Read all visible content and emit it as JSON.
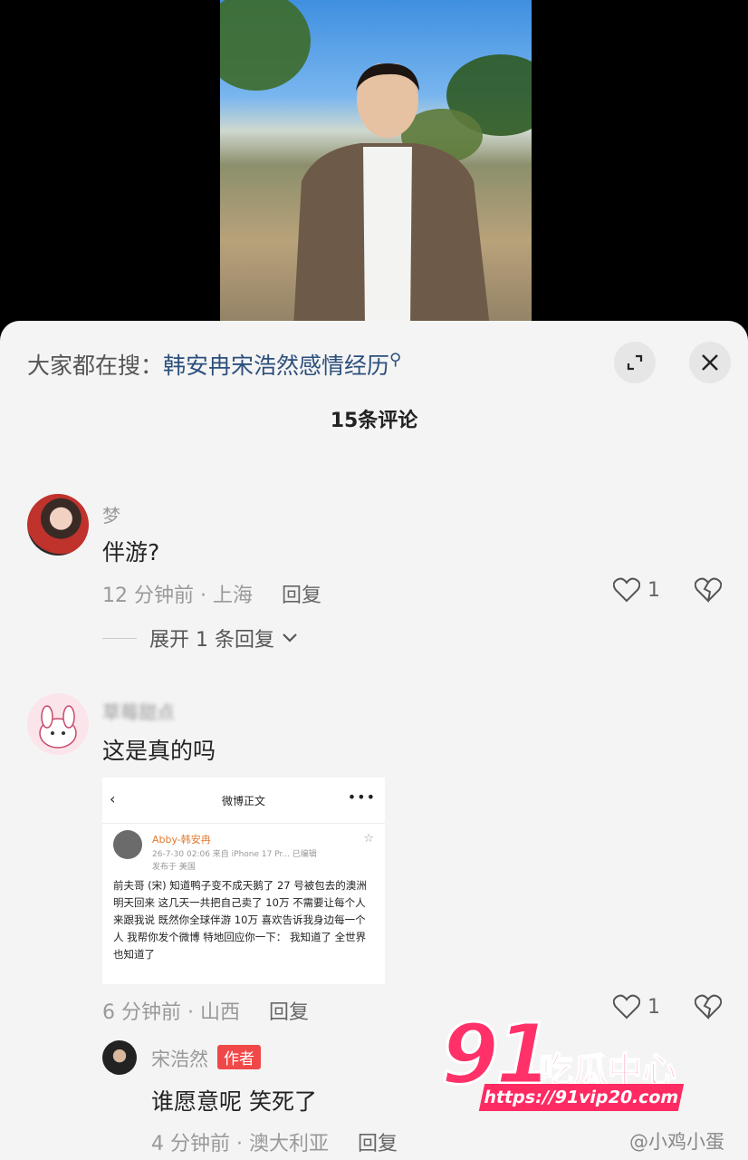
{
  "search": {
    "prefix": "大家都在搜：",
    "query": "韩安冉宋浩然感情经历"
  },
  "comment_count": "15条评论",
  "comments": [
    {
      "username": "梦",
      "text": "伴游?",
      "time_location": "12 分钟前 · 上海",
      "reply_label": "回复",
      "likes": "1",
      "expand_label": "展开 1 条回复"
    },
    {
      "username": "草莓甜点",
      "text": "这是真的吗",
      "time_location": "6 分钟前 · 山西",
      "reply_label": "回复",
      "likes": "1",
      "embedded": {
        "title": "微博正文",
        "author": "Abby-韩安冉",
        "meta": "26-7-30 02:06  来自 iPhone 17 Pr...  已编辑",
        "location": "发布于 美国",
        "body": "前夫哥 (宋) 知道鸭子变不成天鹅了 27 号被包去的澳洲 明天回来 这几天一共把自己卖了 10万 不需要让每个人来跟我说 既然你全球伴游 10万 喜欢告诉我身边每一个人 我帮你发个微博 特地回应你一下： 我知道了 全世界也知道了"
      }
    },
    {
      "username": "宋浩然",
      "author_tag": "作者",
      "text": "谁愿意呢 笑死了",
      "time_location": "4 分钟前 · 澳大利亚",
      "reply_label": "回复"
    }
  ],
  "watermark": {
    "number": "91",
    "brand": "吃瓜中心",
    "url": "https://91vip20.com",
    "weibo": "@小鸡小蛋"
  },
  "colors": {
    "accent_red": "#f04848",
    "link_blue": "#2c4f7c",
    "watermark_pink": "#ff3168"
  }
}
